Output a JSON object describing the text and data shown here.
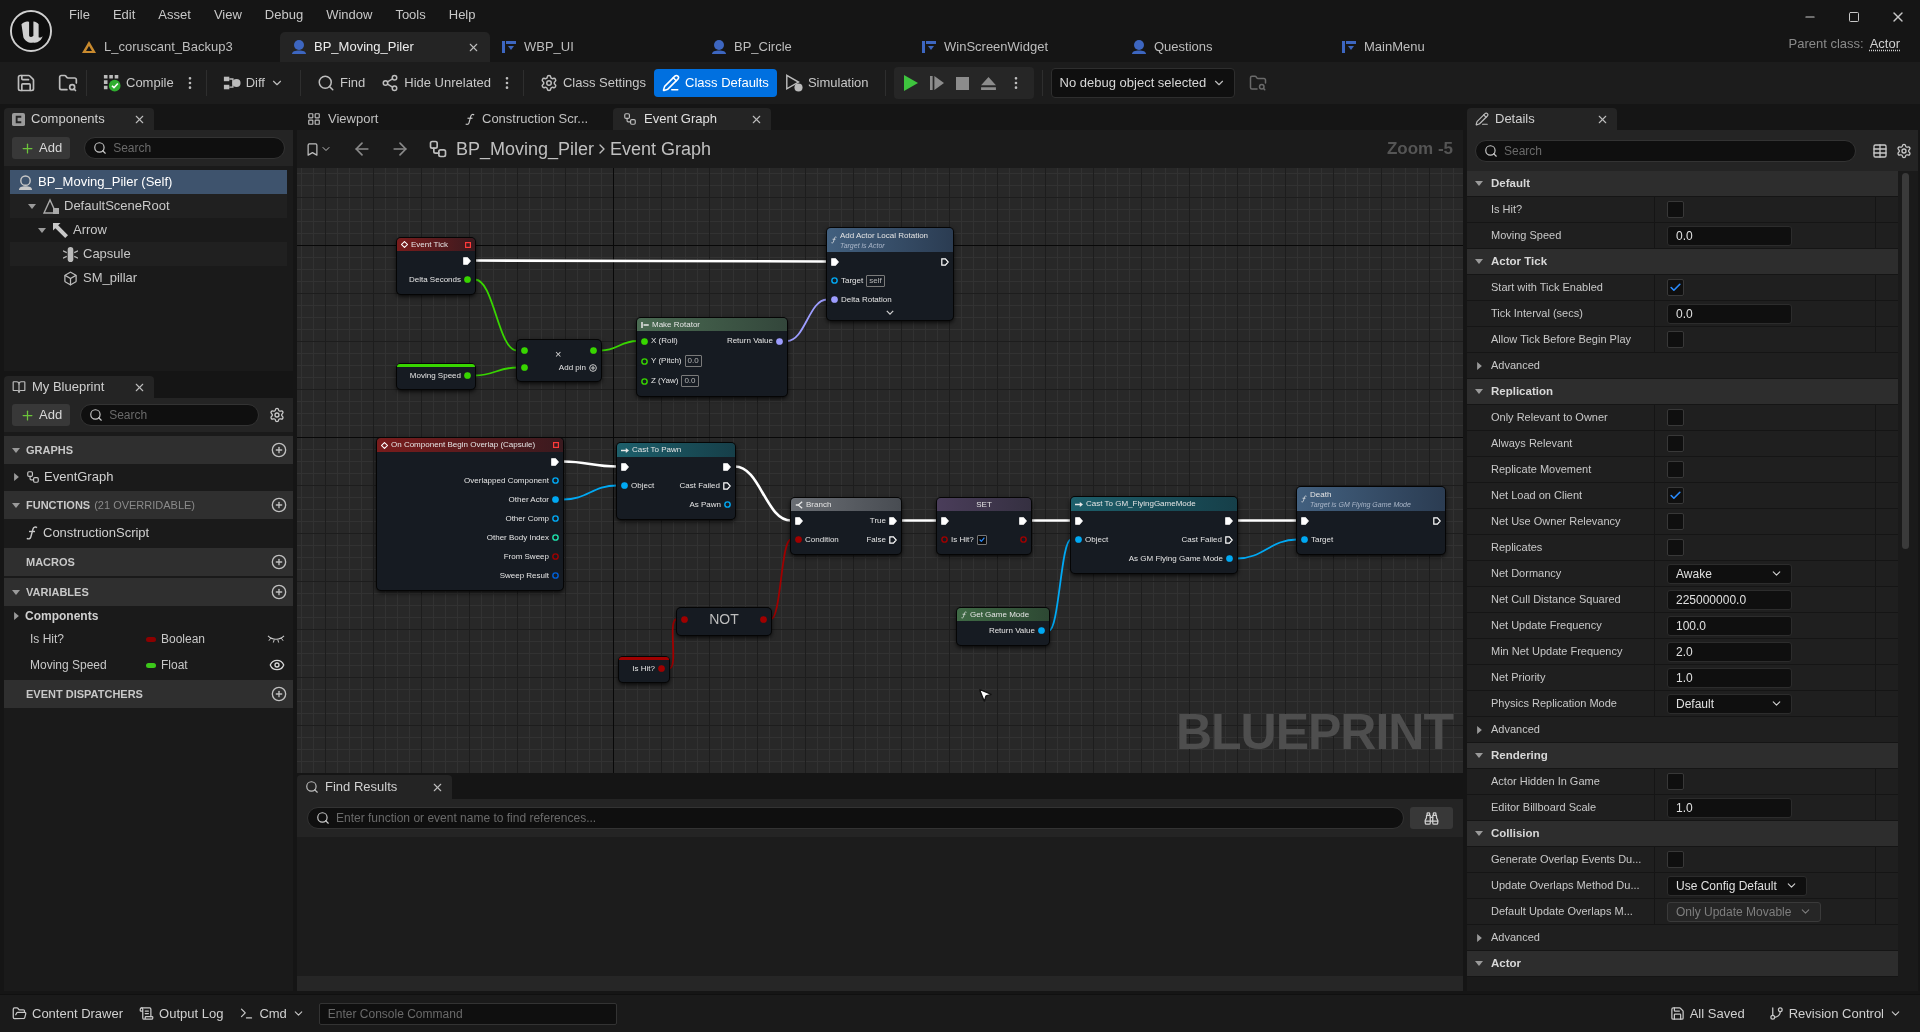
{
  "window": {
    "parent_class_label": "Parent class:",
    "parent_class": "Actor"
  },
  "menu": [
    "File",
    "Edit",
    "Asset",
    "View",
    "Debug",
    "Window",
    "Tools",
    "Help"
  ],
  "document_tabs": [
    {
      "label": "L_coruscant_Backup3",
      "kind": "level",
      "selected": false
    },
    {
      "label": "BP_Moving_Piler",
      "kind": "blueprint",
      "selected": true
    },
    {
      "label": "WBP_UI",
      "kind": "widget",
      "selected": false
    },
    {
      "label": "BP_Circle",
      "kind": "blueprint",
      "selected": false
    },
    {
      "label": "WinScreenWidget",
      "kind": "widget",
      "selected": false
    },
    {
      "label": "Questions",
      "kind": "blueprint",
      "selected": false
    },
    {
      "label": "MainMenu",
      "kind": "widget",
      "selected": false
    }
  ],
  "toolbar": {
    "items": [
      {
        "kind": "compile",
        "label": "Compile",
        "selected": false
      },
      {
        "kind": "diff",
        "label": "Diff",
        "selected": false
      },
      {
        "kind": "find",
        "label": "Find",
        "selected": false
      },
      {
        "kind": "hide_unrelated",
        "label": "Hide Unrelated",
        "selected": false
      },
      {
        "kind": "class_settings",
        "label": "Class Settings",
        "selected": false
      },
      {
        "kind": "class_defaults",
        "label": "Class Defaults",
        "selected": true
      },
      {
        "kind": "simulation",
        "label": "Simulation",
        "selected": false
      }
    ],
    "debug_object": "No debug object selected"
  },
  "components": {
    "title": "Components",
    "add_label": "Add",
    "search_placeholder": "Search",
    "items": [
      {
        "label": "BP_Moving_Piler (Self)",
        "kind": "actor",
        "selected": true,
        "children": [
          {
            "label": "DefaultSceneRoot",
            "kind": "scene_root",
            "selected": false,
            "expanded": true,
            "children": [
              {
                "label": "Arrow",
                "kind": "arrow",
                "selected": false,
                "expanded": true,
                "children": [
                  {
                    "label": "Capsule",
                    "kind": "capsule",
                    "selected": false
                  },
                  {
                    "label": "SM_pillar",
                    "kind": "mesh",
                    "selected": false
                  }
                ]
              }
            ]
          }
        ]
      }
    ]
  },
  "my_blueprint": {
    "title": "My Blueprint",
    "add_label": "Add",
    "search_placeholder": "Search",
    "sections": [
      {
        "title": "GRAPHS",
        "expanded": true,
        "items": [
          {
            "kind": "graph",
            "label": "EventGraph",
            "expanded": false
          }
        ]
      },
      {
        "title": "FUNCTIONS",
        "note": "(21 OVERRIDABLE)",
        "expanded": true,
        "items": [
          {
            "kind": "function",
            "label": "ConstructionScript"
          }
        ]
      },
      {
        "title": "MACROS"
      },
      {
        "title": "VARIABLES",
        "expanded": true,
        "items": [
          {
            "kind": "category",
            "label": "Components",
            "expanded": false
          },
          {
            "kind": "variable",
            "label": "Is Hit?",
            "type": "Boolean",
            "color": "#8c0000",
            "visible": false
          },
          {
            "kind": "variable",
            "label": "Moving Speed",
            "type": "Float",
            "color": "#3cc81a",
            "visible": true
          }
        ]
      },
      {
        "title": "EVENT DISPATCHERS"
      }
    ]
  },
  "graph_tabs": [
    {
      "label": "Viewport",
      "kind": "viewport",
      "selected": false
    },
    {
      "label": "Construction Scr...",
      "kind": "function",
      "selected": false
    },
    {
      "label": "Event Graph",
      "kind": "graph",
      "selected": true
    }
  ],
  "graph": {
    "breadcrumb": [
      "BP_Moving_Piler",
      "Event Graph"
    ],
    "zoom": "Zoom -5",
    "watermark": "BLUEPRINT",
    "nodes": [
      {
        "kind": "event",
        "title": "Event Tick",
        "rows": [
          {
            "out": {
              "kind": "exec",
              "connected": true
            }
          },
          {
            "out": {
              "kind": "float",
              "label": "Delta Seconds",
              "connected": true
            }
          }
        ]
      },
      {
        "kind": "function",
        "title": "Add Actor Local Rotation",
        "subtitle": "Target is Actor",
        "advanced_hidden": true,
        "rows": [
          {
            "in": {
              "kind": "exec",
              "connected": true
            },
            "out": {
              "kind": "exec",
              "connected": false
            }
          },
          {
            "in": {
              "kind": "object",
              "label": "Target",
              "value": "self",
              "connected": false
            }
          },
          {
            "in": {
              "kind": "rotator",
              "label": "Delta Rotation",
              "connected": true
            }
          }
        ]
      },
      {
        "kind": "operator",
        "symbol": "×",
        "footer": "Add pin",
        "rows": [
          {
            "in": {
              "kind": "float",
              "connected": true
            },
            "out": {
              "kind": "float",
              "connected": true
            }
          },
          {
            "in": {
              "kind": "float",
              "connected": true
            }
          }
        ]
      },
      {
        "kind": "getter",
        "rows": [
          {
            "out": {
              "kind": "float",
              "label": "Moving Speed",
              "connected": true
            }
          }
        ]
      },
      {
        "kind": "pure",
        "title": "Make Rotator",
        "rows": [
          {
            "in": {
              "kind": "float",
              "label": "X (Roll)",
              "connected": true
            },
            "out": {
              "kind": "rotator",
              "label": "Return Value",
              "connected": true
            }
          },
          {
            "in": {
              "kind": "float",
              "label": "Y (Pitch)",
              "value": "0.0",
              "connected": false
            }
          },
          {
            "in": {
              "kind": "float",
              "label": "Z (Yaw)",
              "value": "0.0",
              "connected": false
            }
          }
        ]
      },
      {
        "kind": "event",
        "title": "On Component Begin Overlap (Capsule)",
        "rows": [
          {
            "out": {
              "kind": "exec",
              "connected": true
            }
          },
          {
            "out": {
              "kind": "object",
              "label": "Overlapped Component",
              "connected": false
            }
          },
          {
            "out": {
              "kind": "object",
              "label": "Other Actor",
              "connected": true
            }
          },
          {
            "out": {
              "kind": "object",
              "label": "Other Comp",
              "connected": false
            }
          },
          {
            "out": {
              "kind": "int",
              "label": "Other Body Index",
              "connected": false
            }
          },
          {
            "out": {
              "kind": "bool",
              "label": "From Sweep",
              "connected": false
            }
          },
          {
            "out": {
              "kind": "struct",
              "label": "Sweep Result",
              "connected": false
            }
          }
        ]
      },
      {
        "kind": "cast",
        "title": "Cast To Pawn",
        "rows": [
          {
            "in": {
              "kind": "exec",
              "connected": true
            },
            "out": {
              "kind": "exec",
              "connected": true
            }
          },
          {
            "in": {
              "kind": "object",
              "label": "Object",
              "connected": true
            },
            "out": {
              "kind": "exec",
              "label": "Cast Failed",
              "connected": false
            }
          },
          {
            "out": {
              "kind": "object",
              "label": "As Pawn",
              "connected": false
            }
          }
        ]
      },
      {
        "kind": "branch",
        "title": "Branch",
        "rows": [
          {
            "in": {
              "kind": "exec",
              "connected": true
            },
            "out": {
              "kind": "exec",
              "label": "True",
              "connected": true
            }
          },
          {
            "in": {
              "kind": "bool",
              "label": "Condition",
              "connected": true
            },
            "out": {
              "kind": "exec",
              "label": "False",
              "connected": false
            }
          }
        ]
      },
      {
        "kind": "compact",
        "symbol": "NOT",
        "rows": [
          {
            "in": {
              "kind": "bool",
              "connected": true
            },
            "out": {
              "kind": "bool",
              "connected": true
            }
          }
        ]
      },
      {
        "kind": "getter",
        "rows": [
          {
            "out": {
              "kind": "bool",
              "label": "Is Hit?",
              "connected": true
            }
          }
        ]
      },
      {
        "kind": "set",
        "title": "SET",
        "rows": [
          {
            "in": {
              "kind": "exec",
              "connected": true
            },
            "out": {
              "kind": "exec",
              "connected": true
            }
          },
          {
            "in": {
              "kind": "bool",
              "label": "Is Hit?",
              "checked": true,
              "connected": false
            },
            "out": {
              "kind": "bool",
              "connected": false
            }
          }
        ]
      },
      {
        "kind": "cast",
        "title": "Cast To GM_FlyingGameMode",
        "rows": [
          {
            "in": {
              "kind": "exec",
              "connected": true
            },
            "out": {
              "kind": "exec",
              "connected": true
            }
          },
          {
            "in": {
              "kind": "object",
              "label": "Object",
              "connected": true
            },
            "out": {
              "kind": "exec",
              "label": "Cast Failed",
              "connected": false
            }
          },
          {
            "out": {
              "kind": "object",
              "label": "As GM Flying Game Mode",
              "connected": true
            }
          }
        ]
      },
      {
        "kind": "pure_function",
        "title": "Get Game Mode",
        "rows": [
          {
            "out": {
              "kind": "object",
              "label": "Return Value",
              "connected": true
            }
          }
        ]
      },
      {
        "kind": "function",
        "title": "Death",
        "subtitle": "Target is GM Flying Game Mode",
        "rows": [
          {
            "in": {
              "kind": "exec",
              "connected": true
            },
            "out": {
              "kind": "exec",
              "connected": false
            }
          },
          {
            "in": {
              "kind": "object",
              "label": "Target",
              "connected": true
            }
          }
        ]
      }
    ]
  },
  "find_results": {
    "title": "Find Results",
    "search_placeholder": "Enter function or event name to find references..."
  },
  "details": {
    "title": "Details",
    "search_placeholder": "Search",
    "sections": [
      {
        "label": "Default",
        "expanded": true,
        "rows": [
          {
            "kind": "checkbox",
            "label": "Is Hit?",
            "checked": false
          },
          {
            "kind": "number",
            "label": "Moving Speed",
            "value": "0.0"
          }
        ]
      },
      {
        "label": "Actor Tick",
        "expanded": true,
        "rows": [
          {
            "kind": "checkbox",
            "label": "Start with Tick Enabled",
            "checked": true
          },
          {
            "kind": "number",
            "label": "Tick Interval (secs)",
            "value": "0.0"
          },
          {
            "kind": "checkbox",
            "label": "Allow Tick Before Begin Play",
            "checked": false
          },
          {
            "kind": "group",
            "label": "Advanced",
            "expanded": false
          }
        ]
      },
      {
        "label": "Replication",
        "expanded": true,
        "rows": [
          {
            "kind": "checkbox",
            "label": "Only Relevant to Owner",
            "checked": false
          },
          {
            "kind": "checkbox",
            "label": "Always Relevant",
            "checked": false
          },
          {
            "kind": "checkbox",
            "label": "Replicate Movement",
            "checked": false
          },
          {
            "kind": "checkbox",
            "label": "Net Load on Client",
            "checked": true
          },
          {
            "kind": "checkbox",
            "label": "Net Use Owner Relevancy",
            "checked": false
          },
          {
            "kind": "checkbox",
            "label": "Replicates",
            "checked": false
          },
          {
            "kind": "dropdown",
            "label": "Net Dormancy",
            "value": "Awake",
            "disabled": false
          },
          {
            "kind": "number",
            "label": "Net Cull Distance Squared",
            "value": "225000000.0"
          },
          {
            "kind": "number",
            "label": "Net Update Frequency",
            "value": "100.0"
          },
          {
            "kind": "number",
            "label": "Min Net Update Frequency",
            "value": "2.0"
          },
          {
            "kind": "number",
            "label": "Net Priority",
            "value": "1.0"
          },
          {
            "kind": "dropdown",
            "label": "Physics Replication Mode",
            "value": "Default",
            "disabled": false
          },
          {
            "kind": "group",
            "label": "Advanced",
            "expanded": false
          }
        ]
      },
      {
        "label": "Rendering",
        "expanded": true,
        "rows": [
          {
            "kind": "checkbox",
            "label": "Actor Hidden In Game",
            "checked": false
          },
          {
            "kind": "number",
            "label": "Editor Billboard Scale",
            "value": "1.0"
          }
        ]
      },
      {
        "label": "Collision",
        "expanded": true,
        "rows": [
          {
            "kind": "checkbox",
            "label": "Generate Overlap Events Du...",
            "checked": false
          },
          {
            "kind": "dropdown",
            "label": "Update Overlaps Method Du...",
            "value": "Use Config Default",
            "disabled": false
          },
          {
            "kind": "dropdown",
            "label": "Default Update Overlaps M...",
            "value": "Only Update Movable",
            "disabled": true
          },
          {
            "kind": "group",
            "label": "Advanced",
            "expanded": false
          }
        ]
      },
      {
        "label": "Actor",
        "expanded": true
      }
    ]
  },
  "status_bar": {
    "left": [
      {
        "kind": "content_drawer",
        "label": "Content Drawer"
      },
      {
        "kind": "output_log",
        "label": "Output Log"
      },
      {
        "kind": "cmd",
        "label": "Cmd"
      }
    ],
    "console_placeholder": "Enter Console Command",
    "right": [
      {
        "kind": "saved",
        "label": "All Saved"
      },
      {
        "kind": "revision_control",
        "label": "Revision Control"
      }
    ]
  }
}
